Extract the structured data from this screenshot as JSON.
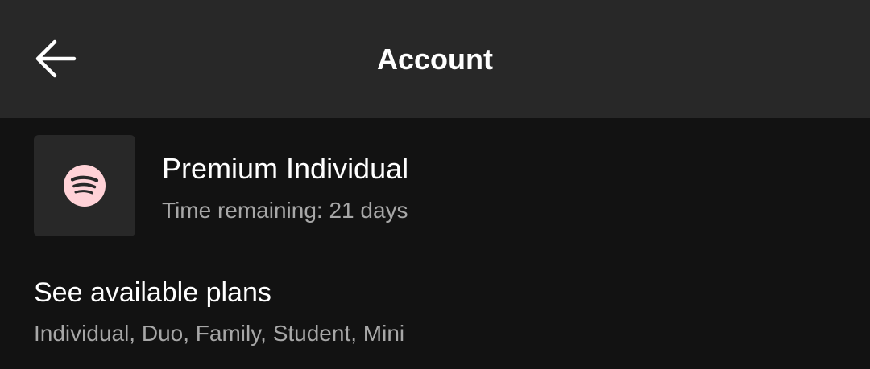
{
  "header": {
    "title": "Account",
    "back_icon": "arrow-left-icon"
  },
  "plan": {
    "name": "Premium Individual",
    "time_remaining": "Time remaining: 21 days",
    "icon": "spotify-logo-icon",
    "icon_color": "#ffd2d7"
  },
  "available_plans": {
    "title": "See available plans",
    "subtitle": "Individual, Duo, Family, Student, Mini"
  },
  "colors": {
    "header_bg": "#282828",
    "page_bg": "#121212",
    "text_primary": "#ffffff",
    "text_secondary": "#a7a7a7"
  }
}
